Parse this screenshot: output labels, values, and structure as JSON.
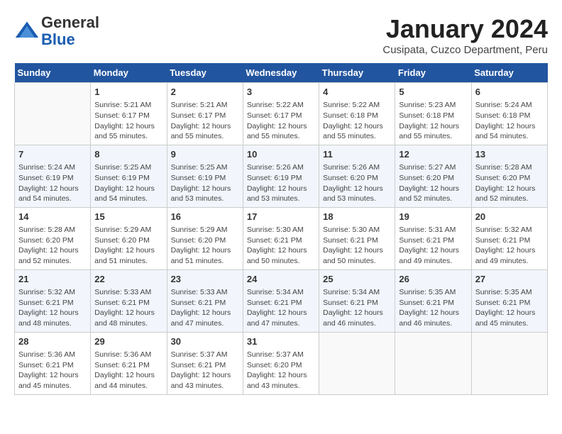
{
  "header": {
    "logo_general": "General",
    "logo_blue": "Blue",
    "month_title": "January 2024",
    "location": "Cusipata, Cuzco Department, Peru"
  },
  "days_of_week": [
    "Sunday",
    "Monday",
    "Tuesday",
    "Wednesday",
    "Thursday",
    "Friday",
    "Saturday"
  ],
  "weeks": [
    [
      {
        "day": "",
        "info": ""
      },
      {
        "day": "1",
        "info": "Sunrise: 5:21 AM\nSunset: 6:17 PM\nDaylight: 12 hours\nand 55 minutes."
      },
      {
        "day": "2",
        "info": "Sunrise: 5:21 AM\nSunset: 6:17 PM\nDaylight: 12 hours\nand 55 minutes."
      },
      {
        "day": "3",
        "info": "Sunrise: 5:22 AM\nSunset: 6:17 PM\nDaylight: 12 hours\nand 55 minutes."
      },
      {
        "day": "4",
        "info": "Sunrise: 5:22 AM\nSunset: 6:18 PM\nDaylight: 12 hours\nand 55 minutes."
      },
      {
        "day": "5",
        "info": "Sunrise: 5:23 AM\nSunset: 6:18 PM\nDaylight: 12 hours\nand 55 minutes."
      },
      {
        "day": "6",
        "info": "Sunrise: 5:24 AM\nSunset: 6:18 PM\nDaylight: 12 hours\nand 54 minutes."
      }
    ],
    [
      {
        "day": "7",
        "info": "Sunrise: 5:24 AM\nSunset: 6:19 PM\nDaylight: 12 hours\nand 54 minutes."
      },
      {
        "day": "8",
        "info": "Sunrise: 5:25 AM\nSunset: 6:19 PM\nDaylight: 12 hours\nand 54 minutes."
      },
      {
        "day": "9",
        "info": "Sunrise: 5:25 AM\nSunset: 6:19 PM\nDaylight: 12 hours\nand 53 minutes."
      },
      {
        "day": "10",
        "info": "Sunrise: 5:26 AM\nSunset: 6:19 PM\nDaylight: 12 hours\nand 53 minutes."
      },
      {
        "day": "11",
        "info": "Sunrise: 5:26 AM\nSunset: 6:20 PM\nDaylight: 12 hours\nand 53 minutes."
      },
      {
        "day": "12",
        "info": "Sunrise: 5:27 AM\nSunset: 6:20 PM\nDaylight: 12 hours\nand 52 minutes."
      },
      {
        "day": "13",
        "info": "Sunrise: 5:28 AM\nSunset: 6:20 PM\nDaylight: 12 hours\nand 52 minutes."
      }
    ],
    [
      {
        "day": "14",
        "info": "Sunrise: 5:28 AM\nSunset: 6:20 PM\nDaylight: 12 hours\nand 52 minutes."
      },
      {
        "day": "15",
        "info": "Sunrise: 5:29 AM\nSunset: 6:20 PM\nDaylight: 12 hours\nand 51 minutes."
      },
      {
        "day": "16",
        "info": "Sunrise: 5:29 AM\nSunset: 6:20 PM\nDaylight: 12 hours\nand 51 minutes."
      },
      {
        "day": "17",
        "info": "Sunrise: 5:30 AM\nSunset: 6:21 PM\nDaylight: 12 hours\nand 50 minutes."
      },
      {
        "day": "18",
        "info": "Sunrise: 5:30 AM\nSunset: 6:21 PM\nDaylight: 12 hours\nand 50 minutes."
      },
      {
        "day": "19",
        "info": "Sunrise: 5:31 AM\nSunset: 6:21 PM\nDaylight: 12 hours\nand 49 minutes."
      },
      {
        "day": "20",
        "info": "Sunrise: 5:32 AM\nSunset: 6:21 PM\nDaylight: 12 hours\nand 49 minutes."
      }
    ],
    [
      {
        "day": "21",
        "info": "Sunrise: 5:32 AM\nSunset: 6:21 PM\nDaylight: 12 hours\nand 48 minutes."
      },
      {
        "day": "22",
        "info": "Sunrise: 5:33 AM\nSunset: 6:21 PM\nDaylight: 12 hours\nand 48 minutes."
      },
      {
        "day": "23",
        "info": "Sunrise: 5:33 AM\nSunset: 6:21 PM\nDaylight: 12 hours\nand 47 minutes."
      },
      {
        "day": "24",
        "info": "Sunrise: 5:34 AM\nSunset: 6:21 PM\nDaylight: 12 hours\nand 47 minutes."
      },
      {
        "day": "25",
        "info": "Sunrise: 5:34 AM\nSunset: 6:21 PM\nDaylight: 12 hours\nand 46 minutes."
      },
      {
        "day": "26",
        "info": "Sunrise: 5:35 AM\nSunset: 6:21 PM\nDaylight: 12 hours\nand 46 minutes."
      },
      {
        "day": "27",
        "info": "Sunrise: 5:35 AM\nSunset: 6:21 PM\nDaylight: 12 hours\nand 45 minutes."
      }
    ],
    [
      {
        "day": "28",
        "info": "Sunrise: 5:36 AM\nSunset: 6:21 PM\nDaylight: 12 hours\nand 45 minutes."
      },
      {
        "day": "29",
        "info": "Sunrise: 5:36 AM\nSunset: 6:21 PM\nDaylight: 12 hours\nand 44 minutes."
      },
      {
        "day": "30",
        "info": "Sunrise: 5:37 AM\nSunset: 6:21 PM\nDaylight: 12 hours\nand 43 minutes."
      },
      {
        "day": "31",
        "info": "Sunrise: 5:37 AM\nSunset: 6:20 PM\nDaylight: 12 hours\nand 43 minutes."
      },
      {
        "day": "",
        "info": ""
      },
      {
        "day": "",
        "info": ""
      },
      {
        "day": "",
        "info": ""
      }
    ]
  ]
}
